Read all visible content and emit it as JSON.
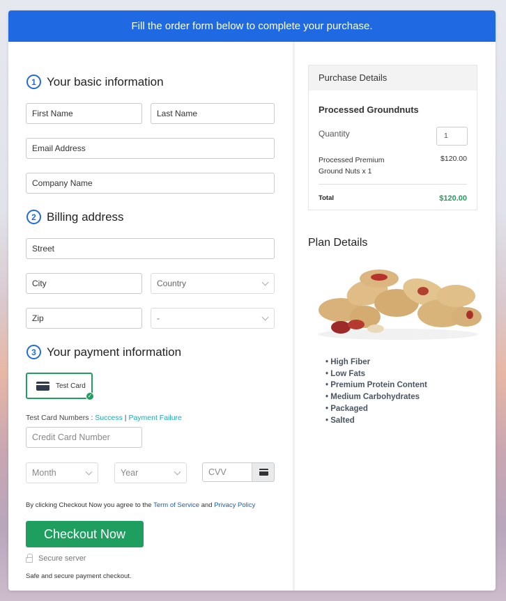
{
  "banner": {
    "text": "Fill the order form below to complete your purchase."
  },
  "sections": {
    "basic": {
      "number": "1",
      "title": "Your basic information"
    },
    "billing": {
      "number": "2",
      "title": "Billing address"
    },
    "payment": {
      "number": "3",
      "title": "Your payment information"
    }
  },
  "fields": {
    "first_name": "First Name",
    "last_name": "Last Name",
    "email": "Email Address",
    "company": "Company Name",
    "street": "Street",
    "city": "City",
    "country": "Country",
    "zip": "Zip",
    "state": "-",
    "card_number": "Credit Card Number",
    "month": "Month",
    "year": "Year",
    "cvv": "CVV"
  },
  "payment": {
    "method_label": "Test Card",
    "test_numbers_label": "Test Card Numbers : ",
    "success_link": "Success",
    "separator": " | ",
    "failure_link": "Payment Failure"
  },
  "agree": {
    "prefix": "By clicking Checkout Now you agree to the ",
    "terms_link": "Term of Service",
    "middle": " and ",
    "privacy_link": "Privacy Policy"
  },
  "checkout_button": "Checkout Now",
  "secure_label": "Secure server",
  "safe_text": "Safe and secure payment checkout.",
  "purchase": {
    "header": "Purchase Details",
    "product": "Processed Groundnuts",
    "quantity_label": "Quantity",
    "quantity_value": "1",
    "item_line": "Processed Premium Ground Nuts x 1",
    "item_price": "$120.00",
    "total_label": "Total",
    "total_value": "$120.00"
  },
  "plan": {
    "title": "Plan Details",
    "image_alt": "peanuts-image",
    "features": [
      "High Fiber",
      "Low Fats",
      "Premium Protein Content",
      "Medium Carbohydrates",
      "Packaged",
      "Salted"
    ]
  },
  "colors": {
    "primary": "#1f6ae3",
    "success": "#1e9e5f",
    "link": "#1ba8b4"
  }
}
